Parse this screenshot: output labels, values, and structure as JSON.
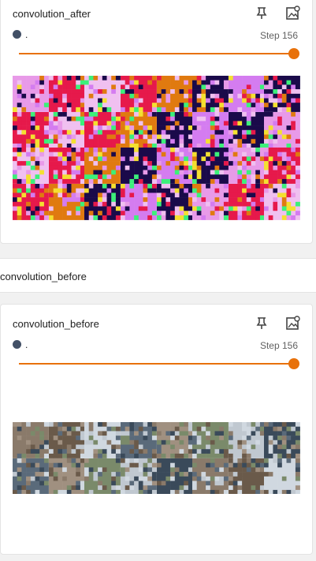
{
  "card_after": {
    "title": "convolution_after",
    "run_label": ".",
    "step_text": "Step 156",
    "slider_value": 1.0,
    "pin_icon": "pin-icon",
    "image_icon": "image-settings-icon",
    "rows": 4,
    "cols": 8
  },
  "group": {
    "label": "convolution_before"
  },
  "card_before": {
    "title": "convolution_before",
    "run_label": ".",
    "step_text": "Step 156",
    "slider_value": 1.0,
    "pin_icon": "pin-icon",
    "image_icon": "image-settings-icon",
    "rows": 2,
    "cols": 8
  },
  "colors": {
    "accent": "#e8710a",
    "run_dot": "#425066",
    "after_palette": [
      "#e89ae8",
      "#d47cf0",
      "#e6194b",
      "#1a0a4a",
      "#e07a10",
      "#f0c0f0",
      "#3cf07a",
      "#f4e030"
    ],
    "before_palette": [
      "#8a7a6a",
      "#5a6a7a",
      "#c0c8d0",
      "#6a5a4a",
      "#a09080",
      "#3a4a5a",
      "#d0d8e0",
      "#7a8a6a"
    ]
  }
}
